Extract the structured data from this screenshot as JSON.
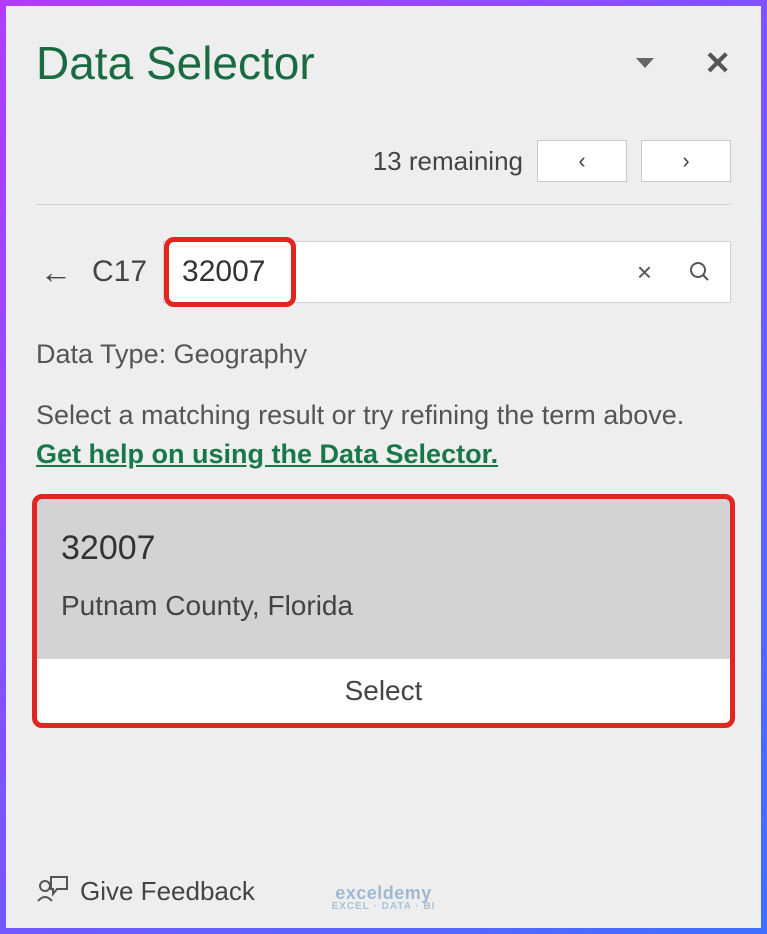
{
  "header": {
    "title": "Data Selector"
  },
  "nav": {
    "remaining_label": "13 remaining",
    "prev": "‹",
    "next": "›"
  },
  "search": {
    "back": "←",
    "cell_ref": "C17",
    "value": "32007",
    "clear": "×"
  },
  "meta": {
    "data_type": "Data Type: Geography",
    "instruction": "Select a matching result or try refining the term above.",
    "help_link": "Get help on using the Data Selector."
  },
  "result": {
    "title": "32007",
    "subtitle": "Putnam County, Florida",
    "select_label": "Select"
  },
  "footer": {
    "feedback": "Give Feedback",
    "watermark_top": "exceldemy",
    "watermark_bottom": "EXCEL · DATA · BI"
  }
}
